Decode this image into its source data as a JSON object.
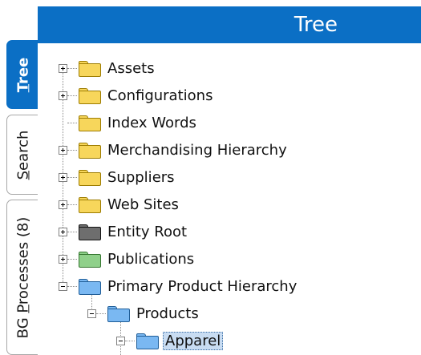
{
  "tabs": [
    {
      "label": "Tree",
      "accel": "T",
      "rest": "ree"
    },
    {
      "label": "Search",
      "accel": "S",
      "rest": "earch"
    },
    {
      "label": "BG Processes (8)",
      "pre": "BG ",
      "accel": "P",
      "rest": "rocesses (8)"
    }
  ],
  "header": {
    "title": "Tree"
  },
  "tree": [
    {
      "label": "Assets",
      "folder": "yellow"
    },
    {
      "label": "Configurations",
      "folder": "yellow"
    },
    {
      "label": "Index Words",
      "folder": "yellow"
    },
    {
      "label": "Merchandising Hierarchy",
      "folder": "yellow"
    },
    {
      "label": "Suppliers",
      "folder": "yellow"
    },
    {
      "label": "Web Sites",
      "folder": "yellow"
    },
    {
      "label": "Entity Root",
      "folder": "gray"
    },
    {
      "label": "Publications",
      "folder": "green"
    },
    {
      "label": "Primary Product Hierarchy",
      "folder": "blue"
    },
    {
      "label": "Products",
      "folder": "blue"
    },
    {
      "label": "Apparel",
      "folder": "blue",
      "selected": true
    }
  ],
  "colors": {
    "accent": "#0b6fc5",
    "folder_yellow": "#f7d65b",
    "folder_gray": "#6e6e6e",
    "folder_green": "#8fd08a",
    "folder_blue": "#7ab8f2",
    "selection": "#c8dcf2"
  }
}
